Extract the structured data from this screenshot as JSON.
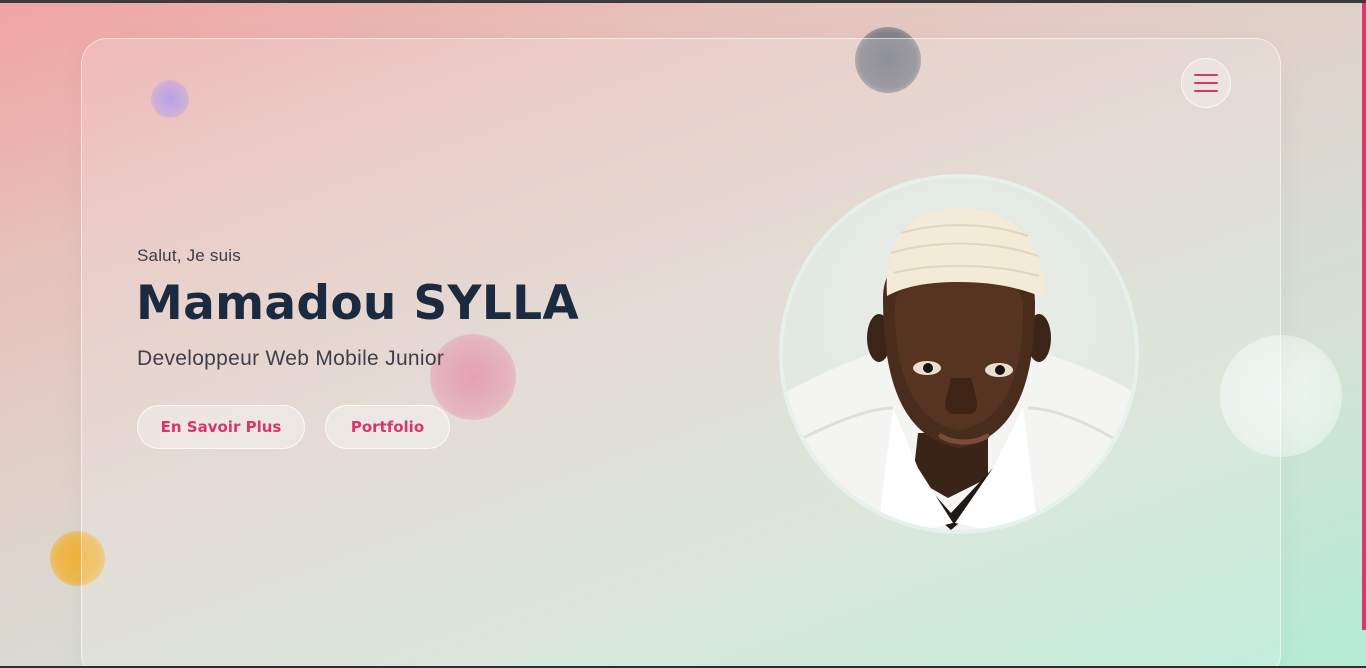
{
  "hero": {
    "greeting": "Salut, Je suis",
    "name": "Mamadou SYLLA",
    "role": "Developpeur Web Mobile Junior"
  },
  "buttons": {
    "more_label": "En Savoir Plus",
    "portfolio_label": "Portfolio"
  },
  "menu": {
    "icon": "hamburger-icon"
  },
  "avatar": {
    "icon": "profile-photo"
  },
  "colors": {
    "accent": "#d9356c",
    "name_text": "#1a2a40",
    "body_text": "#3b3b46"
  }
}
